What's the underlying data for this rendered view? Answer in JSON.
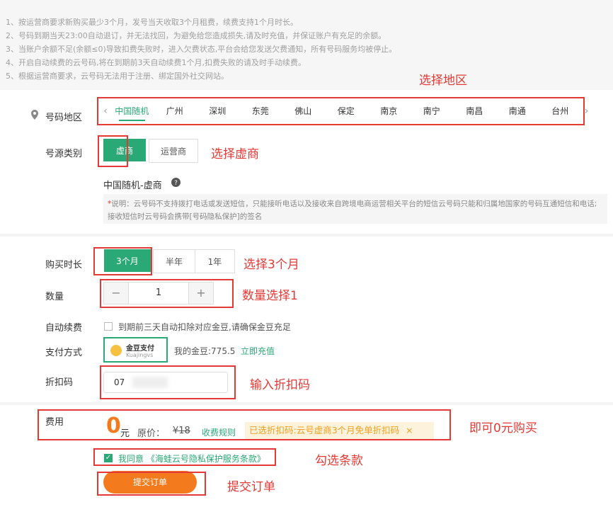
{
  "notice": {
    "lines": [
      "1、按运营商要求新购买最少3个月，发号当天收取3个月租费，续费支持1个月时长。",
      "2、号码到期当天23:00自动退订，并无法找回，为避免给您造成损失,请及时充值，并保证账户有充足的余额。",
      "3、当账户余额不足(余额≤0)导致扣费失败时，进入欠费状态,平台会给您发送欠费通知，所有号码服务均被停止。",
      "4、开启自动续费的云号码,将在到期前3天自动续费1个月,扣费失败的请及时手动续费。",
      "5、根据运营商要求，云号码无法用于注册、绑定国外社交网站。"
    ]
  },
  "region": {
    "label": "号码地区",
    "cities": [
      "中国随机",
      "广州",
      "深圳",
      "东莞",
      "佛山",
      "保定",
      "南京",
      "南宁",
      "南昌",
      "南通",
      "台州"
    ],
    "active_index": 0
  },
  "source_type": {
    "label": "号源类别",
    "options": [
      "虚商",
      "运营商"
    ],
    "active_index": 0,
    "selected_title": "中国随机-虚商",
    "note_star": "*",
    "note": "说明：云号码不支持拨打电话或发送短信，只能接听电话以及接收来自跨境电商运营相关平台的短信云号码只能和归属地国家的号码互通短信和电话;接收短信时云号码会携带[号码隐私保护]的签名"
  },
  "duration": {
    "label": "购买时长",
    "options": [
      "3个月",
      "半年",
      "1年"
    ],
    "active_index": 0
  },
  "quantity": {
    "label": "数量",
    "minus": "−",
    "value": "1",
    "plus": "+"
  },
  "auto_renew": {
    "label": "自动续费",
    "text": "到期前三天自动扣除对应金豆,请确保金豆充足"
  },
  "payment": {
    "label": "支付方式",
    "card_title": "金豆支付",
    "card_sub": "Kuajingvs",
    "balance": "我的金豆:775.5",
    "recharge": "立即充值"
  },
  "coupon": {
    "label": "折扣码",
    "value": "07"
  },
  "fee": {
    "label": "费用",
    "amount": "0",
    "unit": "元",
    "original_label": "原价：",
    "original_price": "¥18",
    "rules_link": "收费规则",
    "coupon_tag": "已选折扣码:云号虚商3个月免单折扣码",
    "coupon_close": "×"
  },
  "agree": {
    "prefix": "我同意",
    "link": "《海蛙云号隐私保护服务条款》"
  },
  "submit": {
    "label": "提交订单"
  },
  "annotations": {
    "region": "选择地区",
    "source": "选择虚商",
    "duration": "选择3个月",
    "quantity": "数量选择1",
    "coupon": "输入折扣码",
    "fee": "即可0元购买",
    "agree": "勾选条款",
    "submit": "提交订单"
  },
  "colors": {
    "accent": "#2aa876",
    "orange": "#f37b1d",
    "annotation_red": "#e53935"
  }
}
